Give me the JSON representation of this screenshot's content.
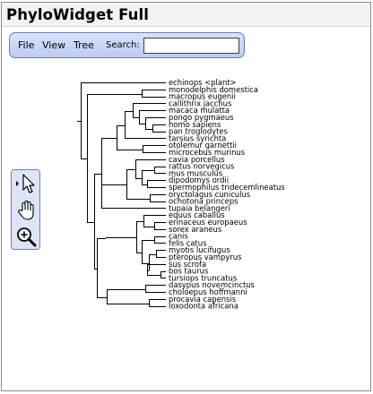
{
  "app": {
    "title": "PhyloWidget Full"
  },
  "menubar": {
    "items": [
      "File",
      "View",
      "Tree"
    ],
    "search_label": "Search:",
    "search_value": "",
    "search_placeholder": ""
  },
  "tools": [
    {
      "name": "arrow-select-tool",
      "icon": "arrow-cursor-icon",
      "selected": true
    },
    {
      "name": "hand-pan-tool",
      "icon": "hand-icon",
      "selected": false
    },
    {
      "name": "zoom-tool",
      "icon": "magnifier-plus-icon",
      "selected": false
    }
  ],
  "tree": {
    "leaves": [
      "echinops <plant>",
      "monodelphis domestica",
      "macropus eugenii",
      "callithrix jacchus",
      "macaca mulatta",
      "pongo pygmaeus",
      "homo sapiens",
      "pan troglodytes",
      "tarsius syrichta",
      "otolemur garnettii",
      "microcebus murinus",
      "cavia porcellus",
      "rattus norvegicus",
      "mus musculus",
      "dipodomys ordii",
      "spermophilus tridecemlineatus",
      "oryctolagus cuniculus",
      "ochotona princeps",
      "tupaia belangeri",
      "equus caballus",
      "erinaceus europaeus",
      "sorex araneus",
      "canis",
      "felis catus",
      "myotis lucifugus",
      "pteropus vampyrus",
      "sus scrofa",
      "bos taurus",
      "tursiops truncatus",
      "dasypus novemcinctus",
      "choloepus hoffmanni",
      "procavia capensis",
      "loxodonta africana"
    ]
  }
}
